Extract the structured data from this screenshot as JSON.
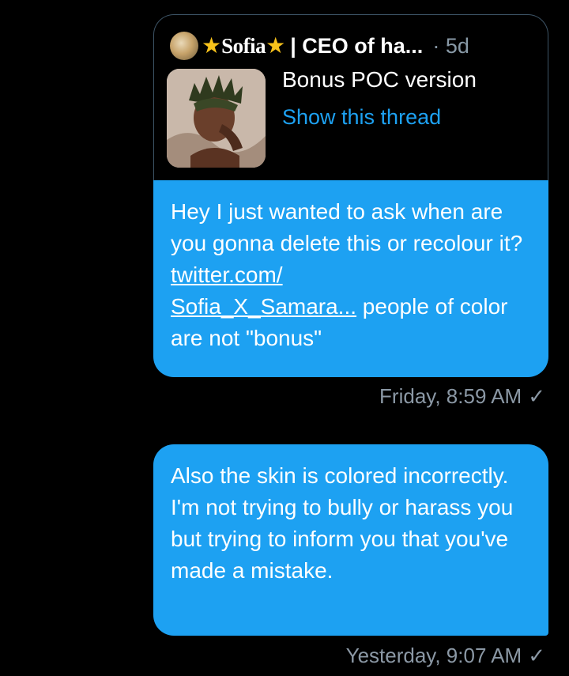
{
  "quoted_tweet": {
    "author_name": "Sofia",
    "author_handle_rest": "| CEO of ha...",
    "star_icon": "★",
    "separator": "·",
    "time": "5d",
    "text": "Bonus POC version",
    "thread_link": "Show this thread"
  },
  "messages": [
    {
      "parts": {
        "before_link": "Hey I just wanted to ask when are you gonna delete this or recolour it? ",
        "link_line1": "twitter.com/",
        "link_line2": "Sofia_X_Samara...",
        "after_link": " people of color are not \"bonus\""
      },
      "timestamp": "Friday, 8:59 AM",
      "status_icon": "✓"
    },
    {
      "text": "Also the skin is colored incorrectly. I'm not trying to bully or harass you but trying to inform you that you've made a mistake.",
      "timestamp": "Yesterday, 9:07 AM",
      "status_icon": "✓"
    }
  ],
  "colors": {
    "background": "#000000",
    "bubble": "#1da1f2",
    "link": "#1da1f2",
    "meta": "#8b98a5",
    "star": "#f7c21b"
  }
}
